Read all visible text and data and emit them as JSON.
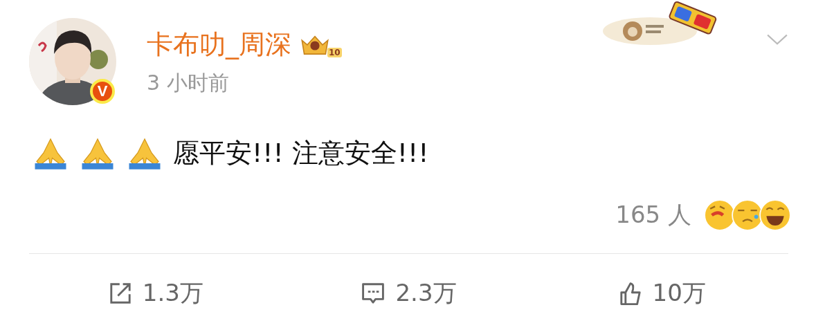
{
  "author": {
    "name": "卡布叻_周深",
    "level_badge": "10",
    "verified_badge": "V",
    "time": "3 小时前"
  },
  "post": {
    "emojis": [
      {
        "kind": "praying-hands"
      },
      {
        "kind": "praying-hands"
      },
      {
        "kind": "praying-hands"
      }
    ],
    "text": "愿平安!!! 注意安全!!!"
  },
  "reactions": {
    "count": "165 人",
    "emojis": [
      {
        "kind": "blush"
      },
      {
        "kind": "cry"
      },
      {
        "kind": "laugh"
      }
    ]
  },
  "actions": [
    {
      "kind": "repost",
      "count": "1.3万"
    },
    {
      "kind": "comment",
      "count": "2.3万"
    },
    {
      "kind": "like",
      "count": "10万"
    }
  ]
}
